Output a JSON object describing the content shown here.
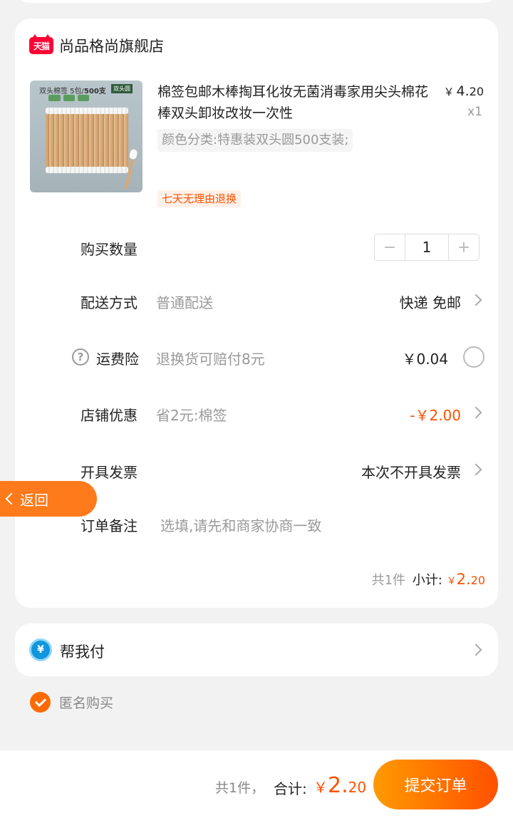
{
  "store": {
    "logo_text": "天猫",
    "name": "尚品格尚旗舰店"
  },
  "product": {
    "image_label_prefix": "双头棉签 5包/",
    "image_label_bold": "500支",
    "image_tag": "双头圆",
    "title": "棉签包邮木棒掏耳化妆无菌消毒家用尖头棉花棒双头卸妆改妆一次性",
    "price_currency": "￥",
    "price_int": "4.",
    "price_dec": "20",
    "quantity_text": "x1",
    "sku": "颜色分类:特惠装双头圆500支装;",
    "return_tag": "七天无理由退换"
  },
  "rows": {
    "quantity": {
      "label": "购买数量",
      "minus": "−",
      "value": "1",
      "plus": "+"
    },
    "delivery": {
      "label": "配送方式",
      "sub": "普通配送",
      "value": "快递 免邮"
    },
    "insurance": {
      "help": "?",
      "label": "运费险",
      "sub": "退换货可赔付8元",
      "value": "￥0.04"
    },
    "discount": {
      "label": "店铺优惠",
      "sub": "省2元:棉签",
      "value": "-￥2.00"
    },
    "invoice": {
      "label": "开具发票",
      "value": "本次不开具发票"
    },
    "remark": {
      "label": "订单备注",
      "placeholder": "选填,请先和商家协商一致"
    }
  },
  "subtotal": {
    "count": "共1件",
    "label": "小计:",
    "currency": "￥",
    "int": "2.",
    "dec": "20"
  },
  "pay_for_me": {
    "icon": "¥",
    "label": "帮我付"
  },
  "anonymous": {
    "label": "匿名购买",
    "checked": true
  },
  "back": {
    "label": "返回"
  },
  "footer": {
    "count": "共1件，",
    "label": "合计:",
    "currency": "￥",
    "int": "2.",
    "dec": "20",
    "submit": "提交订单"
  },
  "colors": {
    "accent": "#ff5000",
    "back_button": "#ff7a1a",
    "tmall_red": "#ff0036"
  }
}
